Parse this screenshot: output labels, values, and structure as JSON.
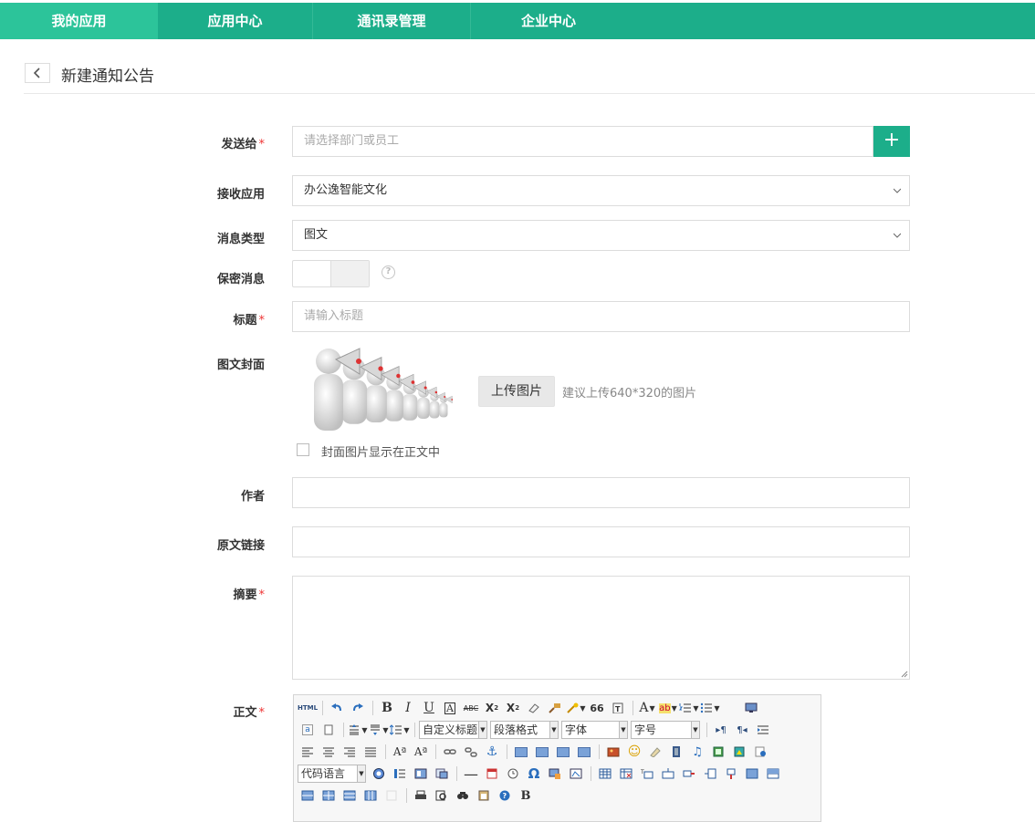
{
  "nav": {
    "tabs": [
      {
        "label": "我的应用",
        "active": true
      },
      {
        "label": "应用中心"
      },
      {
        "label": "通讯录管理"
      },
      {
        "label": "企业中心"
      }
    ]
  },
  "page": {
    "title": "新建通知公告"
  },
  "form": {
    "send_to": {
      "label": "发送给",
      "placeholder": "请选择部门或员工"
    },
    "receive_app": {
      "label": "接收应用",
      "value": "办公逸智能文化"
    },
    "msg_type": {
      "label": "消息类型",
      "value": "图文"
    },
    "confidential": {
      "label": "保密消息"
    },
    "title": {
      "label": "标题",
      "placeholder": "请输入标题"
    },
    "cover": {
      "label": "图文封面",
      "upload_label": "上传图片",
      "hint": "建议上传640*320的图片",
      "show_in_body_label": "封面图片显示在正文中"
    },
    "author": {
      "label": "作者",
      "value": ""
    },
    "source_link": {
      "label": "原文链接",
      "value": ""
    },
    "summary": {
      "label": "摘要",
      "value": ""
    },
    "body": {
      "label": "正文"
    }
  },
  "editor": {
    "selects": {
      "custom_heading": "自定义标题",
      "paragraph": "段落格式",
      "font": "字体",
      "size": "字号",
      "code_lang": "代码语言"
    },
    "text_buttons": {
      "html": "HTML",
      "bold": "B",
      "italic": "I",
      "underline": "U",
      "quote": "66",
      "omega": "Ω",
      "last_b": "B"
    }
  },
  "colors": {
    "accent": "#1cae8a",
    "accent_active": "#2cc49a",
    "required": "#e33333"
  }
}
